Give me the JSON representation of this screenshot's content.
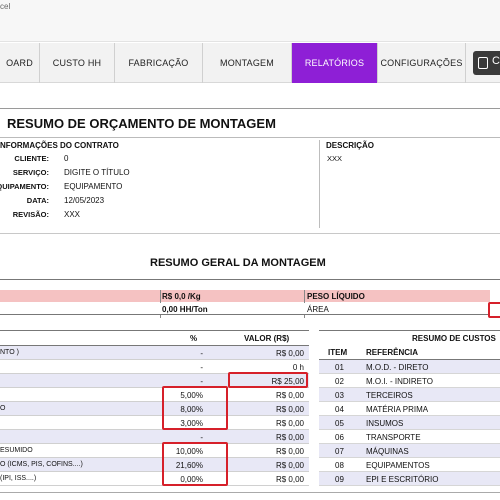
{
  "window": {
    "title": "cel"
  },
  "nav": {
    "tabs": [
      {
        "label": "OARD",
        "active": false
      },
      {
        "label": "CUSTO HH",
        "active": false
      },
      {
        "label": "FABRICAÇÃO",
        "active": false
      },
      {
        "label": "MONTAGEM",
        "active": false
      },
      {
        "label": "RELATÓRIOS",
        "active": true
      },
      {
        "label": "CONFIGURAÇÕES",
        "active": false
      }
    ],
    "tool_icon": "document-icon",
    "tool_label": "C"
  },
  "report": {
    "title": "RESUMO DE ORÇAMENTO DE MONTAGEM",
    "contract": {
      "heading": "NFORMAÇÕES DO CONTRATO",
      "fields": [
        {
          "label": "CLIENTE:",
          "value": "0"
        },
        {
          "label": "SERVIÇO:",
          "value": "DIGITE O TÍTULO"
        },
        {
          "label": "QUIPAMENTO:",
          "value": "EQUIPAMENTO"
        },
        {
          "label": "DATA:",
          "value": "12/05/2023"
        },
        {
          "label": "REVISÃO:",
          "value": "XXX"
        }
      ]
    },
    "description": {
      "heading": "DESCRIÇÃO",
      "value": "XXX"
    }
  },
  "summary": {
    "title": "RESUMO GERAL DA MONTAGEM",
    "pink_row": {
      "price_per_kg": "R$ 0,0 /Kg",
      "weight_label": "PESO LÍQUIDO"
    },
    "white_row": {
      "hh_per_ton": "0,00 HH/Ton",
      "area_label": "ÁREA"
    }
  },
  "costs": {
    "headers": {
      "pct": "%",
      "value": "VALOR (R$)"
    },
    "rows": [
      {
        "label": "NTO )",
        "pct": "-",
        "value": "R$ 0,00"
      },
      {
        "label": "",
        "pct": "-",
        "value": "0 h"
      },
      {
        "label": "",
        "pct": "-",
        "value": "R$ 25,00"
      },
      {
        "label": "",
        "pct": "5,00%",
        "value": "R$ 0,00"
      },
      {
        "label": "O",
        "pct": "8,00%",
        "value": "R$ 0,00"
      },
      {
        "label": "",
        "pct": "3,00%",
        "value": "R$ 0,00"
      },
      {
        "label": "",
        "pct": "-",
        "value": "R$ 0,00"
      },
      {
        "label": "ESUMIDO",
        "pct": "10,00%",
        "value": "R$ 0,00"
      },
      {
        "label": "O  (ICMS, PIS, COFINS....)",
        "pct": "21,60%",
        "value": "R$ 0,00"
      },
      {
        "label": "(IPI, ISS....)",
        "pct": "0,00%",
        "value": "R$ 0,00"
      }
    ]
  },
  "cost_summary": {
    "title": "RESUMO DE CUSTOS",
    "headers": {
      "item": "ITEM",
      "ref": "REFERÊNCIA"
    },
    "items": [
      {
        "item": "01",
        "ref": "M.O.D. - DIRETO"
      },
      {
        "item": "02",
        "ref": "M.O.I. - INDIRETO"
      },
      {
        "item": "03",
        "ref": "TERCEIROS"
      },
      {
        "item": "04",
        "ref": "MATÉRIA PRIMA"
      },
      {
        "item": "05",
        "ref": "INSUMOS"
      },
      {
        "item": "06",
        "ref": "TRANSPORTE"
      },
      {
        "item": "07",
        "ref": "MÁQUINAS"
      },
      {
        "item": "08",
        "ref": "EQUIPAMENTOS"
      },
      {
        "item": "09",
        "ref": "EPI E ESCRITÓRIO"
      }
    ]
  },
  "colors": {
    "accent": "#8e1fd6",
    "highlight": "#d6202a",
    "pink": "#f5c2c2",
    "lavender": "#e8e8f6"
  }
}
